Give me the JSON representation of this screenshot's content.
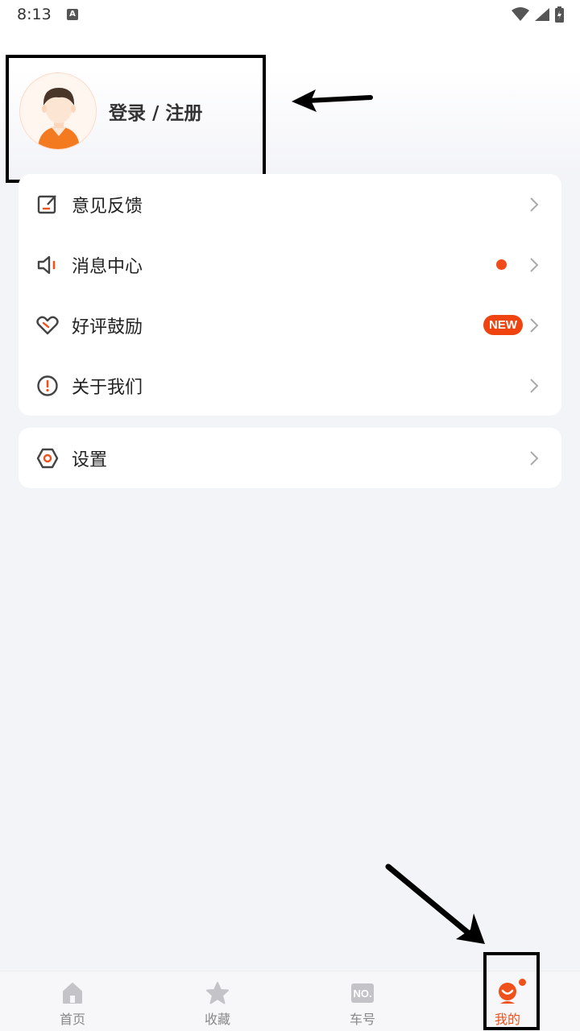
{
  "status_bar": {
    "time": "8:13",
    "notif_icon_letter": "A"
  },
  "profile": {
    "login_label": "登录 / 注册",
    "avatar_icon": "user-avatar-icon"
  },
  "menu": {
    "group1": [
      {
        "label": "意见反馈",
        "icon": "feedback-edit-icon"
      },
      {
        "label": "消息中心",
        "icon": "speaker-icon",
        "has_dot": true
      },
      {
        "label": "好评鼓励",
        "icon": "heart-icon",
        "badge": "NEW"
      },
      {
        "label": "关于我们",
        "icon": "info-exclamation-icon"
      }
    ],
    "group2": [
      {
        "label": "设置",
        "icon": "settings-hex-icon"
      }
    ]
  },
  "bottom_nav": {
    "items": [
      {
        "label": "首页",
        "icon": "home-icon"
      },
      {
        "label": "收藏",
        "icon": "star-icon"
      },
      {
        "label": "车号",
        "icon": "plate-number-icon",
        "icon_text": "NO."
      },
      {
        "label": "我的",
        "icon": "mine-icon",
        "active": true,
        "has_dot": true
      }
    ]
  },
  "colors": {
    "accent": "#f0501a",
    "badge": "#f04410",
    "background": "#f3f4f8"
  }
}
